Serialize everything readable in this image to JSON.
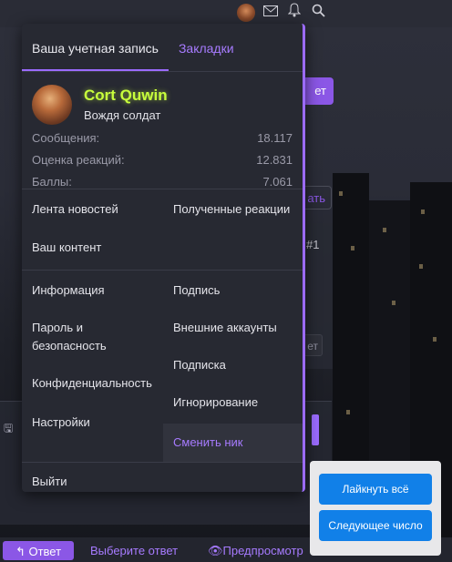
{
  "header": {
    "icons": [
      "user-avatar",
      "mail-icon",
      "bell-icon",
      "search-icon"
    ]
  },
  "menu": {
    "tabs": [
      {
        "label": "Ваша учетная запись"
      },
      {
        "label": "Закладки"
      }
    ],
    "profile": {
      "name": "Cort Quwin",
      "title": "Вождя солдат",
      "stats": [
        {
          "label": "Сообщения:",
          "value": "18.117"
        },
        {
          "label": "Оценка реакций:",
          "value": "12.831"
        },
        {
          "label": "Баллы:",
          "value": "7.061"
        }
      ]
    },
    "section1": {
      "left": [
        "Лента новостей",
        "Ваш контент"
      ],
      "right": [
        "Полученные реакции"
      ]
    },
    "section2": {
      "left": [
        "Информация",
        "Пароль и безопасность",
        "Конфиденциальность",
        "Настройки"
      ],
      "right": [
        "Подпись",
        "Внешние аккаунты",
        "Подписка",
        "Игнорирование",
        "Сменить ник"
      ]
    },
    "logout": "Выйти"
  },
  "background": {
    "button1": "ет",
    "button2": "ать",
    "post_number": "#1",
    "button3": "ет"
  },
  "popup": {
    "like_all": "Лайкнуть всё",
    "next_number": "Следующее число"
  },
  "bottom_bar": {
    "reply": "Ответ",
    "pick_answer": "Выберите ответ",
    "preview": "Предпросмотр"
  },
  "colors": {
    "accent": "#9b6bff",
    "button_purple": "#8b57e6",
    "username_green": "#c8ff3c",
    "popup_blue": "#1180e8"
  }
}
